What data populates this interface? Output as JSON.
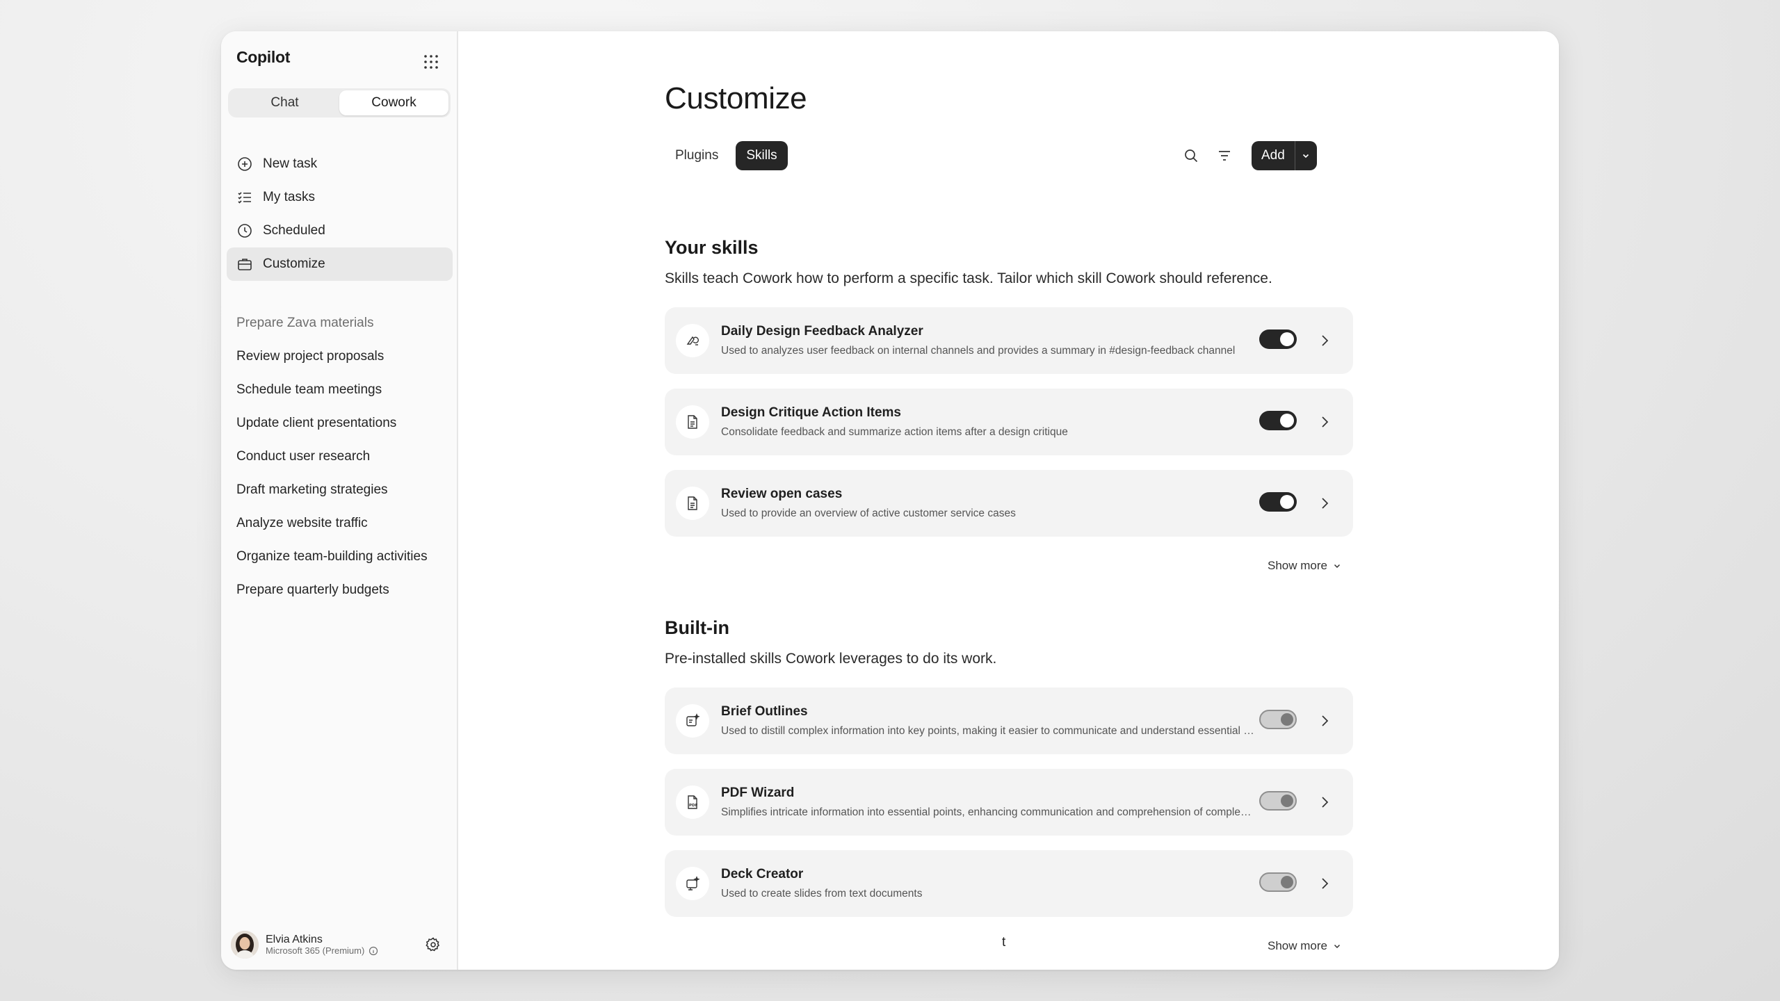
{
  "sidebar": {
    "brand": "Copilot",
    "mode_tabs": [
      {
        "label": "Chat",
        "active": false
      },
      {
        "label": "Cowork",
        "active": true
      }
    ],
    "nav": [
      {
        "label": "New task",
        "icon": "plus-circle-icon"
      },
      {
        "label": "My tasks",
        "icon": "task-list-icon"
      },
      {
        "label": "Scheduled",
        "icon": "clock-icon"
      },
      {
        "label": "Customize",
        "icon": "briefcase-icon",
        "active": true
      }
    ],
    "tasks": [
      "Prepare Zava materials",
      "Review project proposals",
      "Schedule team meetings",
      "Update client presentations",
      "Conduct user research",
      "Draft marketing strategies",
      "Analyze website traffic",
      "Organize team-building activities",
      "Prepare quarterly budgets"
    ],
    "user": {
      "name": "Elvia Atkins",
      "plan": "Microsoft 365 (Premium)"
    }
  },
  "main": {
    "title": "Customize",
    "tabs": [
      {
        "label": "Plugins",
        "active": false
      },
      {
        "label": "Skills",
        "active": true
      }
    ],
    "add_label": "Add",
    "your_skills": {
      "title": "Your skills",
      "subtitle": "Skills teach Cowork how to perform a specific task. Tailor which skill Cowork should reference.",
      "items": [
        {
          "title": "Daily Design Feedback Analyzer",
          "desc": "Used to analyzes user feedback on internal channels and provides a summary in #design-feedback channel",
          "icon": "design-feedback-icon",
          "enabled": true
        },
        {
          "title": "Design Critique Action Items",
          "desc": "Consolidate feedback and summarize action items after a design critique",
          "icon": "document-icon",
          "enabled": true
        },
        {
          "title": "Review open cases",
          "desc": "Used to provide an overview of active customer service cases",
          "icon": "document-icon",
          "enabled": true
        }
      ],
      "show_more": "Show more"
    },
    "built_in": {
      "title": "Built-in",
      "subtitle": "Pre-installed skills Cowork leverages to do its work.",
      "items": [
        {
          "title": "Brief Outlines",
          "desc": "Used to distill complex information into key points, making it easier to communicate and understand essential ideas",
          "icon": "sparkle-doc-icon",
          "enabled": false
        },
        {
          "title": "PDF Wizard",
          "desc": "Simplifies intricate information into essential points, enhancing communication and comprehension of complex ideas",
          "icon": "pdf-icon",
          "enabled": false
        },
        {
          "title": "Deck Creator",
          "desc": "Used to create slides from text documents",
          "icon": "slides-sparkle-icon",
          "enabled": false
        }
      ],
      "show_more": "Show more"
    },
    "stray_text": "t"
  }
}
